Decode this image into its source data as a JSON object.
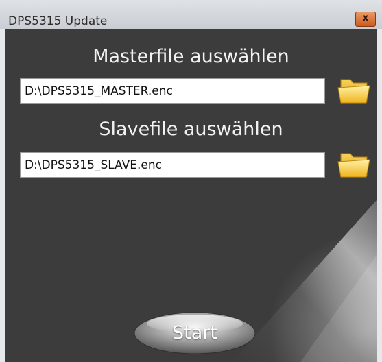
{
  "window": {
    "title": "DPS5315 Update",
    "close_label": "x"
  },
  "master": {
    "heading": "Masterfile auswählen",
    "path": "D:\\DPS5315_MASTER.enc",
    "browse_icon": "folder-icon"
  },
  "slave": {
    "heading": "Slavefile auswählen",
    "path": "D:\\DPS5315_SLAVE.enc",
    "browse_icon": "folder-icon"
  },
  "start_button": {
    "label": "Start"
  },
  "colors": {
    "background": "#3c3c3c",
    "text": "#f2f2f2",
    "close_button": "#cc5a1f",
    "folder": "#f3c232"
  }
}
